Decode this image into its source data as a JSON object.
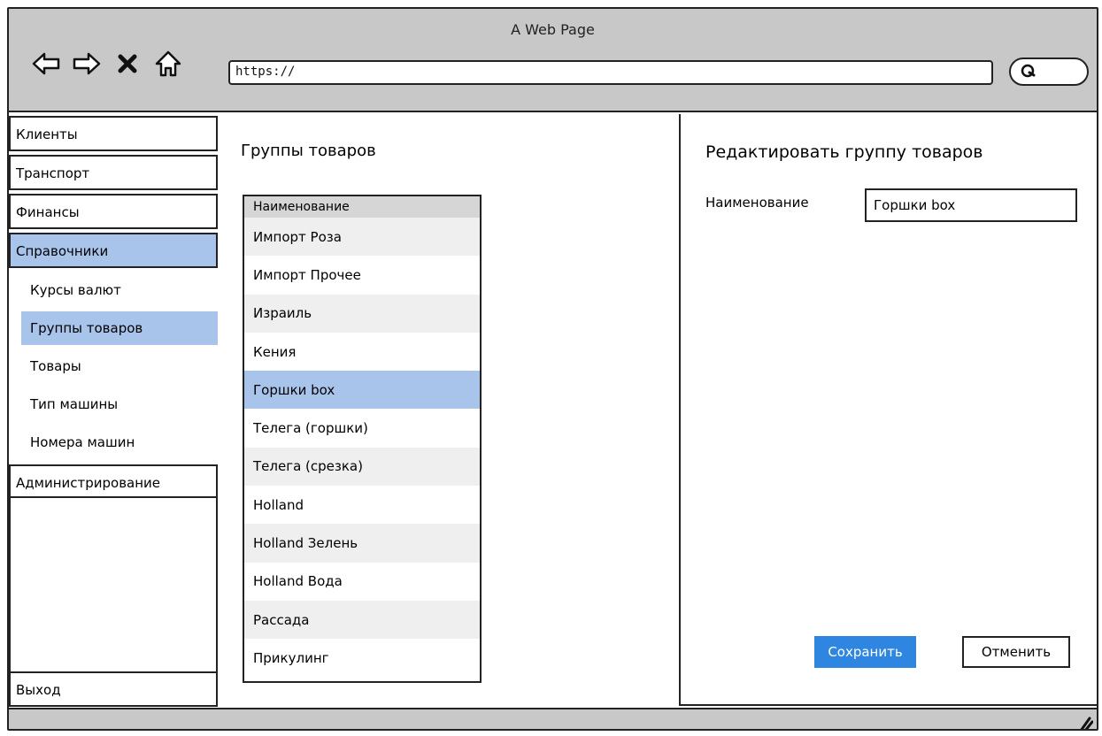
{
  "window": {
    "title": "A Web Page"
  },
  "browser": {
    "url": "https://",
    "icons": [
      "back-arrow-icon",
      "forward-arrow-icon",
      "close-x-icon",
      "home-icon",
      "search-icon"
    ]
  },
  "sidebar": {
    "items": [
      {
        "label": "Клиенты"
      },
      {
        "label": "Транспорт"
      },
      {
        "label": "Финансы"
      },
      {
        "label": "Справочники",
        "active": true
      }
    ],
    "subitems": [
      {
        "label": "Курсы валют"
      },
      {
        "label": "Группы товаров",
        "active": true
      },
      {
        "label": "Товары"
      },
      {
        "label": "Тип машины"
      },
      {
        "label": "Номера машин"
      }
    ],
    "admin_label": "Администрирование",
    "exit_label": "Выход"
  },
  "main": {
    "title": "Группы товаров",
    "list": {
      "header": "Наименование",
      "rows": [
        "Импорт Роза",
        "Импорт Прочее",
        "Израиль",
        "Кения",
        "Горшки box",
        "Телега (горшки)",
        "Телега (срезка)",
        "Holland",
        "Holland Зелень",
        "Holland Вода",
        "Рассада",
        "Прикулинг"
      ],
      "selected_index": 4
    }
  },
  "editor": {
    "title": "Редактировать группу товаров",
    "field_label": "Наименование",
    "field_value": "Горшки box",
    "save_label": "Сохранить",
    "cancel_label": "Отменить"
  },
  "colors": {
    "chrome": "#c8c8c8",
    "selection": "#a9c4eb",
    "primary_button": "#2f86e0",
    "row_alt": "#efefef"
  }
}
